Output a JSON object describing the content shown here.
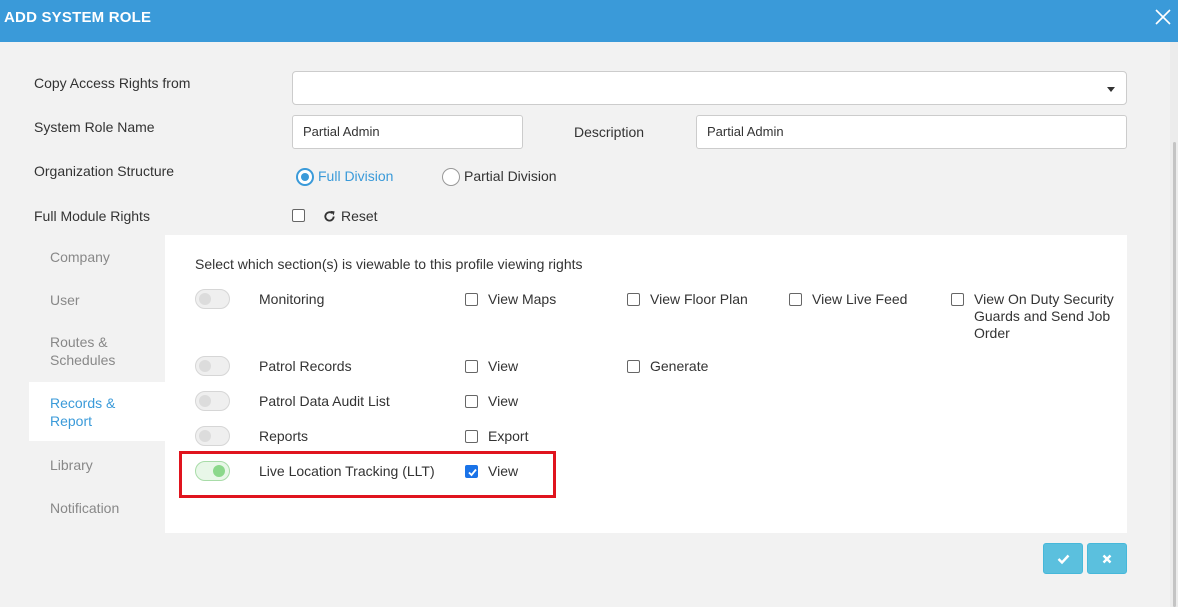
{
  "dialog": {
    "title": "ADD SYSTEM ROLE"
  },
  "form": {
    "copy_access_label": "Copy Access Rights from",
    "copy_access_value": "",
    "role_name_label": "System Role Name",
    "role_name_value": "Partial Admin",
    "description_label": "Description",
    "description_value": "Partial Admin",
    "org_structure_label": "Organization Structure",
    "org_options": [
      {
        "label": "Full Division",
        "selected": true
      },
      {
        "label": "Partial Division",
        "selected": false
      }
    ],
    "full_module_label": "Full Module Rights",
    "full_module_checked": false,
    "reset_label": "Reset"
  },
  "sidebar": {
    "items": [
      {
        "label": "Company",
        "active": false
      },
      {
        "label": "User",
        "active": false
      },
      {
        "label": "Routes & Schedules",
        "active": false
      },
      {
        "label": "Records & Report",
        "active": true
      },
      {
        "label": "Library",
        "active": false
      },
      {
        "label": "Notification",
        "active": false
      }
    ]
  },
  "panel": {
    "instruction": "Select which section(s) is viewable to this profile viewing rights",
    "rows": [
      {
        "name": "Monitoring",
        "enabled": false,
        "options": [
          {
            "label": "View Maps",
            "checked": false
          },
          {
            "label": "View Floor Plan",
            "checked": false
          },
          {
            "label": "View Live Feed",
            "checked": false
          },
          {
            "label": "View On Duty Security Guards and Send Job Order",
            "checked": false
          }
        ]
      },
      {
        "name": "Patrol Records",
        "enabled": false,
        "options": [
          {
            "label": "View",
            "checked": false
          },
          {
            "label": "Generate",
            "checked": false
          }
        ]
      },
      {
        "name": "Patrol Data Audit List",
        "enabled": false,
        "options": [
          {
            "label": "View",
            "checked": false
          }
        ]
      },
      {
        "name": "Reports",
        "enabled": false,
        "options": [
          {
            "label": "Export",
            "checked": false
          }
        ]
      },
      {
        "name": "Live Location Tracking (LLT)",
        "enabled": true,
        "options": [
          {
            "label": "View",
            "checked": true
          }
        ]
      }
    ]
  },
  "colors": {
    "header": "#3a9ad9",
    "accent": "#3a9ad9",
    "highlight": "#e0141e",
    "button": "#5bc0de"
  },
  "icons": {
    "close": "close-icon",
    "reset": "refresh-icon",
    "confirm": "check-icon",
    "cancel": "times-icon"
  }
}
